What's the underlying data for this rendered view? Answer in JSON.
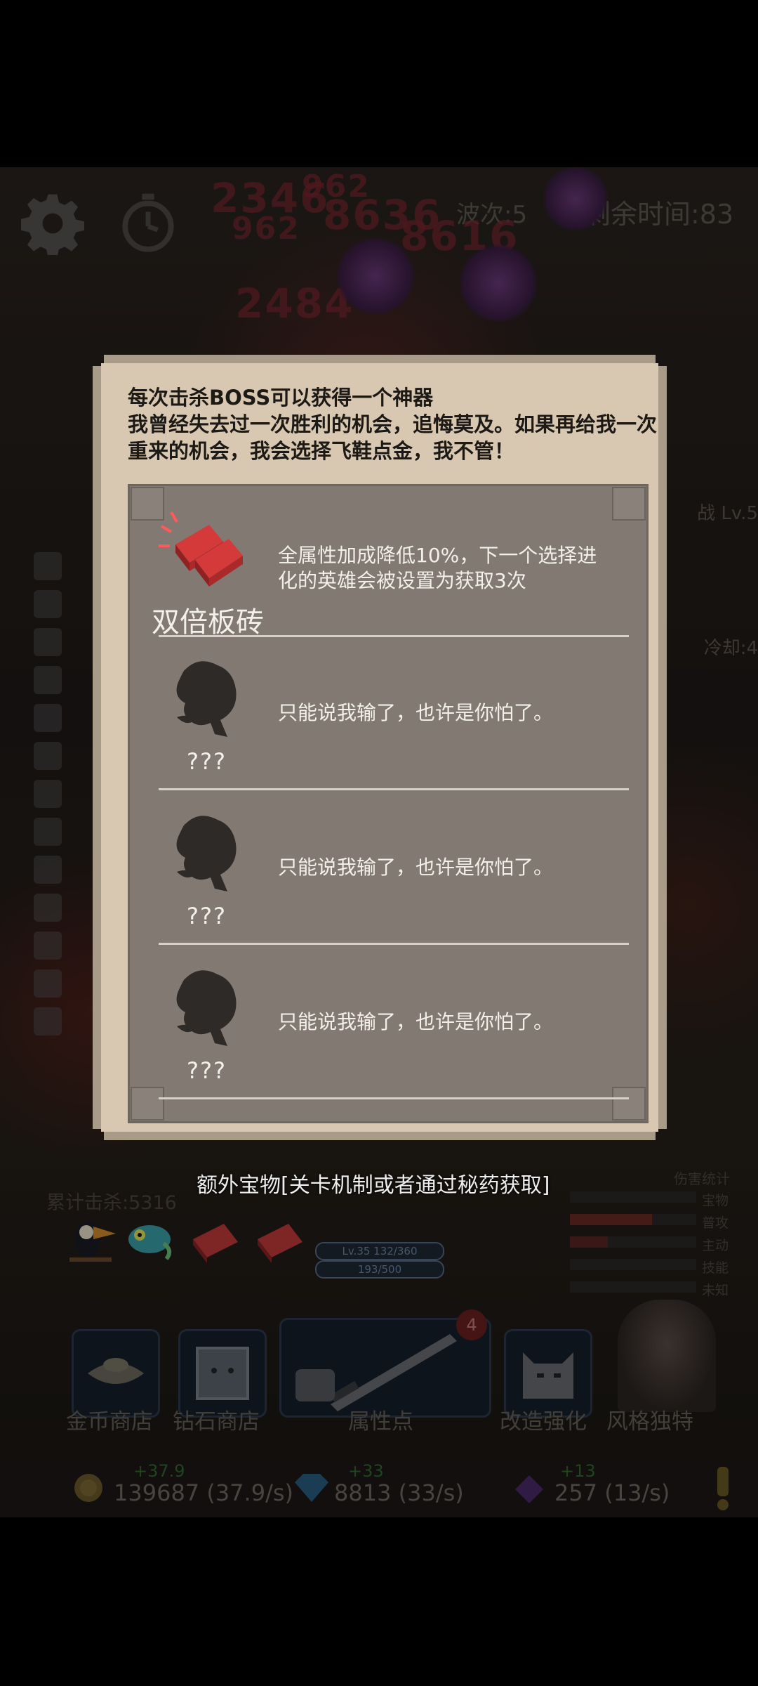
{
  "hud": {
    "wave": "波次:5",
    "time_left": "剩余时间:83",
    "damage_numbers": [
      "2346",
      "962",
      "8636",
      "8616",
      "962",
      "2484"
    ],
    "side_labels": [
      "战 Lv.5",
      "冷却:4"
    ]
  },
  "dialog": {
    "intro_line1": "每次击杀BOSS可以获得一个神器",
    "intro_line2": "我曾经失去过一次胜利的机会，追悔莫及。如果再给我一次重来的机会，我会选择飞鞋点金，我不管！",
    "items": [
      {
        "name": "双倍板砖",
        "desc": "全属性加成降低10%，下一个选择进化的英雄会被设置为获取3次",
        "icon": "double-brick-icon"
      },
      {
        "name": "???",
        "desc": "只能说我输了，也许是你怕了。",
        "icon": "locked-artifact-icon"
      },
      {
        "name": "???",
        "desc": "只能说我输了，也许是你怕了。",
        "icon": "locked-artifact-icon"
      },
      {
        "name": "???",
        "desc": "只能说我输了，也许是你怕了。",
        "icon": "locked-artifact-icon"
      }
    ]
  },
  "caption": "额外宝物[关卡机制或者通过秘药获取]",
  "kill_count": "累计击杀:5316",
  "level_bar": "Lv.35 132/360",
  "hp_bar": "193/500",
  "damage_stats": {
    "title": "伤害统计",
    "rows": [
      {
        "label": "宝物",
        "fill": 0.0
      },
      {
        "label": "普攻",
        "fill": 0.65
      },
      {
        "label": "主动",
        "fill": 0.3
      },
      {
        "label": "技能",
        "fill": 0.0
      },
      {
        "label": "未知",
        "fill": 0.0
      }
    ]
  },
  "bottom_nav": {
    "gold_shop": "金币商店",
    "diamond_shop": "钻石商店",
    "attribute_points": "属性点",
    "attribute_badge": "4",
    "upgrade": "改造强化",
    "style": "风格独特"
  },
  "currencies": {
    "gold": {
      "inc": "+37.9",
      "value": "139687 (37.9/s)"
    },
    "diamond": {
      "inc": "+33",
      "value": "8813 (33/s)"
    },
    "gem": {
      "inc": "+13",
      "value": "257 (13/s)"
    }
  },
  "colors": {
    "dialog_frame": "#d9c8b1",
    "list_bg": "#827a72",
    "brick_red": "#d43a3a"
  }
}
